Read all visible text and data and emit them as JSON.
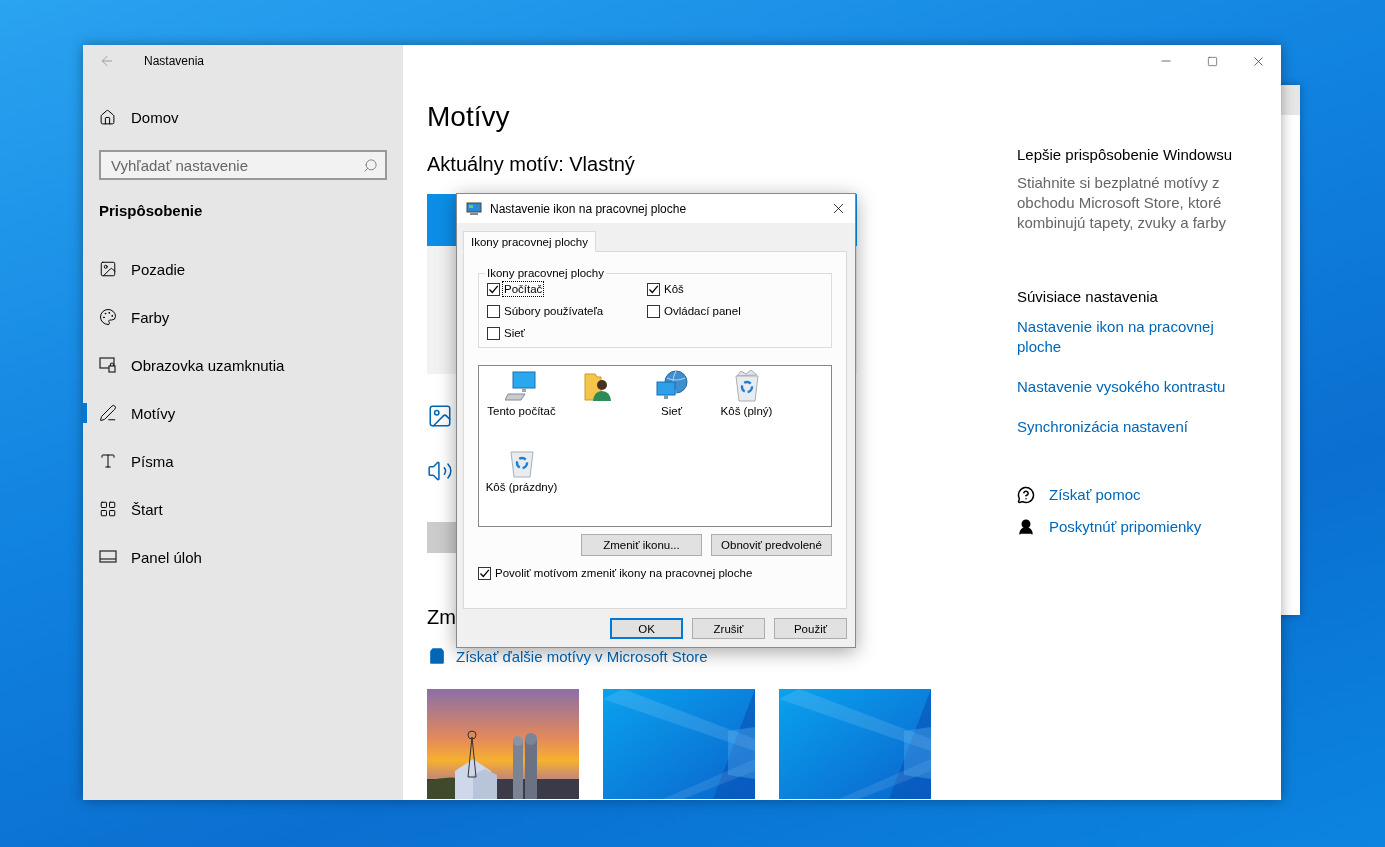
{
  "settings_window": {
    "title": "Nastavenia",
    "home": "Domov",
    "search": {
      "placeholder": "Vyhľadať nastavenie"
    },
    "section": "Prispôsobenie",
    "nav": [
      {
        "label": "Pozadie",
        "selected": false
      },
      {
        "label": "Farby",
        "selected": false
      },
      {
        "label": "Obrazovka uzamknutia",
        "selected": false
      },
      {
        "label": "Motívy",
        "selected": true
      },
      {
        "label": "Písma",
        "selected": false
      },
      {
        "label": "Štart",
        "selected": false
      },
      {
        "label": "Panel úloh",
        "selected": false
      }
    ],
    "page_title": "Motívy",
    "current_theme": "Aktuálny motív: Vlastný",
    "change_heading": "Zm",
    "store_link": "Získať ďalšie motívy v Microsoft Store",
    "themes": [
      {
        "kind": "picture"
      },
      {
        "kind": "picture"
      },
      {
        "kind": "picture"
      }
    ],
    "promo": {
      "heading": "Lepšie prispôsobenie Windowsu",
      "text": "Stiahnite si bezplatné motívy z obchodu Microsoft Store, ktoré kombinujú tapety, zvuky a farby"
    },
    "related": {
      "heading": "Súvisiace nastavenia",
      "links": [
        "Nastavenie ikon na pracovnej ploche",
        "Nastavenie vysokého kontrastu",
        "Synchronizácia nastavení"
      ]
    },
    "help": [
      "Získať pomoc",
      "Poskytnúť pripomienky"
    ]
  },
  "dialog": {
    "title": "Nastavenie ikon na pracovnej ploche",
    "tabs": [
      {
        "label": "Ikony pracovnej plochy",
        "selected": true
      }
    ],
    "group": {
      "legend": "Ikony pracovnej plochy",
      "checkboxes": [
        {
          "label": "Počítač",
          "checked": true,
          "focused": true
        },
        {
          "label": "Kôš",
          "checked": true,
          "focused": false
        },
        {
          "label": "Súbory používateľa",
          "checked": false,
          "focused": false
        },
        {
          "label": "Ovládací panel",
          "checked": false,
          "focused": false
        },
        {
          "label": "Sieť",
          "checked": false,
          "focused": false
        }
      ]
    },
    "icons": [
      {
        "kind": "computer",
        "label": "Tento počítač"
      },
      {
        "kind": "user"
      },
      {
        "kind": "network",
        "label": "Sieť"
      },
      {
        "kind": "bin-full",
        "label": "Kôš (plný)"
      },
      {
        "kind": "bin-empty",
        "label": "Kôš (prázdny)"
      }
    ],
    "icon_buttons": [
      "Zmeniť ikonu...",
      "Obnoviť predvolené"
    ],
    "allow_themes": {
      "label": "Povoliť motívom zmeniť ikony na pracovnej ploche",
      "checked": true
    },
    "footer_buttons": [
      {
        "label": "OK",
        "default": true
      },
      {
        "label": "Zrušiť",
        "default": false
      },
      {
        "label": "Použiť",
        "default": false
      }
    ]
  }
}
